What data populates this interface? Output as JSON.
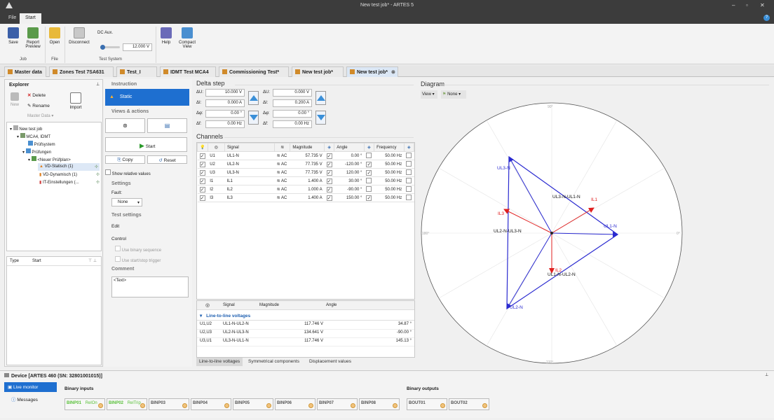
{
  "window": {
    "title": "New test job* - ARTES 5"
  },
  "menu": {
    "file": "File",
    "start": "Start"
  },
  "ribbon": {
    "save": "Save",
    "report_preview": "Report Preview",
    "open": "Open",
    "disconnect": "Disconnect",
    "dc_aux": "DC Aux.",
    "dc_value": "12.000 V",
    "help": "Help",
    "compact_view": "Compact View",
    "grp_job": "Job",
    "grp_file": "File",
    "grp_test_system": "Test System"
  },
  "tabs": [
    "Master data",
    "Zones Test 7SA631",
    "Test_I",
    "IDMT Test MCA4",
    "Commissioning Test*",
    "New test job*",
    "New test job*"
  ],
  "explorer": {
    "title": "Explorer",
    "new": "New",
    "delete": "Delete",
    "rename": "Rename",
    "master_data": "Master Data",
    "import": "Import",
    "tree": [
      "New test job",
      "MCA4, IDMT",
      "Prüfsystem",
      "Prüfungen",
      "<Neuer Prüfplan>",
      "VD-Statisch (1)",
      "VD-Dynamisch (1)",
      "IT-Einstellungen (..."
    ],
    "col_type": "Type",
    "col_start": "Start"
  },
  "instr": {
    "h_instruction": "Instruction",
    "static": "Static",
    "h_views": "Views & actions",
    "start": "Start",
    "copy": "Copy",
    "reset": "Reset",
    "show_relative": "Show relative values",
    "h_settings": "Settings",
    "fault": "Fault:",
    "fault_value": "None",
    "h_test_settings": "Test settings",
    "edit": "Edit",
    "control": "Control",
    "use_binary": "Use binary sequence",
    "use_trigger": "Use start/stop trigger",
    "h_comment": "Comment",
    "comment": "<Text>"
  },
  "delta": {
    "title": "Delta step",
    "left": [
      {
        "label": "ΔU:",
        "value": "10.000 V"
      },
      {
        "label": "ΔI:",
        "value": "0.000 A"
      },
      {
        "label": "Δφ:",
        "value": "0.00 °"
      },
      {
        "label": "Δf:",
        "value": "0.00 Hz"
      }
    ],
    "right": [
      {
        "label": "ΔU:",
        "value": "0.000 V"
      },
      {
        "label": "ΔI:",
        "value": "0.200 A"
      },
      {
        "label": "Δφ:",
        "value": "0.00 °"
      },
      {
        "label": "Δf:",
        "value": "0.00 Hz"
      }
    ]
  },
  "channels": {
    "title": "Channels",
    "h_signal": "Signal",
    "h_magnitude": "Magnitude",
    "h_angle": "Angle",
    "h_frequency": "Frequency",
    "rows": [
      {
        "id": "U1",
        "signal": "UL1-N",
        "type": "AC",
        "mag": "57.735 V",
        "ang": "0.00 °",
        "freq": "50.00 Hz",
        "angchk": false
      },
      {
        "id": "U2",
        "signal": "UL2-N",
        "type": "AC",
        "mag": "77.735 V",
        "ang": "-120.00 °",
        "freq": "50.00 Hz",
        "angchk": true
      },
      {
        "id": "U3",
        "signal": "UL3-N",
        "type": "AC",
        "mag": "77.735 V",
        "ang": "120.00 °",
        "freq": "50.00 Hz",
        "angchk": true
      },
      {
        "id": "I1",
        "signal": "IL1",
        "type": "AC",
        "mag": "1.400 A",
        "ang": "30.00 °",
        "freq": "50.00 Hz",
        "angchk": false
      },
      {
        "id": "I2",
        "signal": "IL2",
        "type": "AC",
        "mag": "1.000 A",
        "ang": "-90.00 °",
        "freq": "50.00 Hz",
        "angchk": false
      },
      {
        "id": "I3",
        "signal": "IL3",
        "type": "AC",
        "mag": "1.400 A",
        "ang": "150.00 °",
        "freq": "50.00 Hz",
        "angchk": true
      }
    ]
  },
  "ll": {
    "h_signal": "Signal",
    "h_magnitude": "Magnitude",
    "h_angle": "Angle",
    "group": "Line-to-line voltages",
    "rows": [
      {
        "id": "U1,U2",
        "signal": "UL1-N-UL2-N",
        "mag": "117.746 V",
        "ang": "34.87 °"
      },
      {
        "id": "U2,U3",
        "signal": "UL2-N-UL3-N",
        "mag": "134.641 V",
        "ang": "-90.00 °"
      },
      {
        "id": "U3,U1",
        "signal": "UL3-N-UL1-N",
        "mag": "117.746 V",
        "ang": "145.13 °"
      }
    ],
    "tabs": [
      "Line-to-line voltages",
      "Symmetrical components",
      "Displacement values"
    ]
  },
  "diagram": {
    "title": "Diagram",
    "view": "View",
    "none": "None",
    "deg90": "90°",
    "deg180": "180°",
    "deg0": "0°",
    "deg270": "270°",
    "labels": {
      "ul1": "UL1-N",
      "ul2": "UL2-N",
      "ul3": "UL3-N",
      "il1": "IL1",
      "il2": "IL2",
      "il3": "IL3",
      "ul3ul1": "UL3-N-UL1-N",
      "ul2ul3": "UL2-N-UL3-N",
      "ul1ul2": "UL1-N-UL2-N"
    },
    "colors": {
      "voltage": "#2a2ad0",
      "current": "#e02020"
    }
  },
  "device": {
    "title": "Device [ARTES 460 (SN: 32801001015)]",
    "live_monitor": "Live monitor",
    "messages": "Messages",
    "binary_inputs": "Binary inputs",
    "binary_outputs": "Binary outputs",
    "binputs": [
      {
        "n": "BINP01",
        "s": "RelOn"
      },
      {
        "n": "BINP02",
        "s": "RelTrip"
      },
      {
        "n": "BINP03",
        "s": ""
      },
      {
        "n": "BINP04",
        "s": ""
      },
      {
        "n": "BINP05",
        "s": ""
      },
      {
        "n": "BINP06",
        "s": ""
      },
      {
        "n": "BINP07",
        "s": ""
      },
      {
        "n": "BINP08",
        "s": ""
      }
    ],
    "boutputs": [
      "BOUT01",
      "BOUT02"
    ]
  }
}
